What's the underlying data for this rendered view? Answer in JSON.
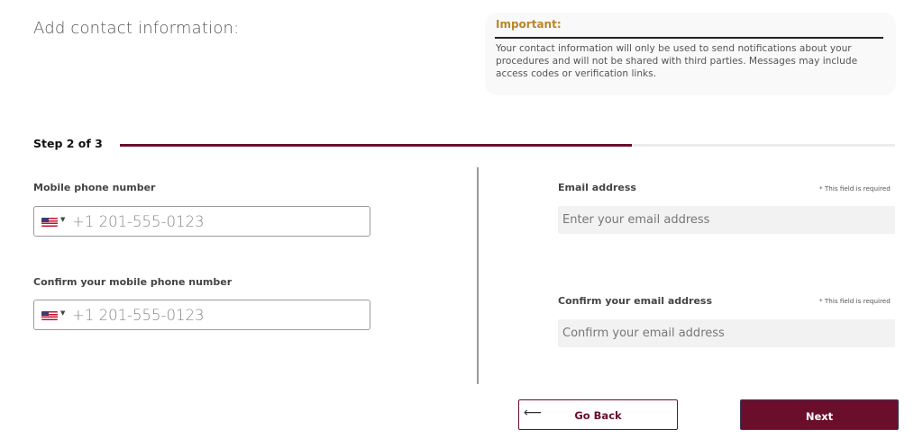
{
  "page": {
    "heading": "Add contact information:"
  },
  "notice": {
    "title": "Important:",
    "body": "Your contact information will only be used to send notifications about your procedures and will not be shared with third parties. Messages may include access codes or verification links."
  },
  "progress": {
    "label": "Step 2 of 3",
    "current_step": 2,
    "total_steps": 3,
    "fill_fraction": 0.66
  },
  "phone": {
    "label": "Mobile phone number",
    "placeholder": "+1 201-555-0123",
    "country_flag_icon": "us-flag-icon",
    "confirm_label": "Confirm your mobile phone number",
    "confirm_placeholder": "+1 201-555-0123"
  },
  "email": {
    "label": "Email address",
    "required_note": "* This field is required",
    "placeholder": "Enter your email address",
    "confirm_label": "Confirm your email address",
    "confirm_required_note": "* This field is required",
    "confirm_placeholder": "Confirm your email address"
  },
  "buttons": {
    "back_label": "Go Back",
    "back_icon": "arrow-left-icon",
    "next_label": "Next"
  },
  "colors": {
    "brand": "#6b0e2c",
    "notice_title": "#b8872a",
    "email_field_bg": "#f2f2f2"
  }
}
